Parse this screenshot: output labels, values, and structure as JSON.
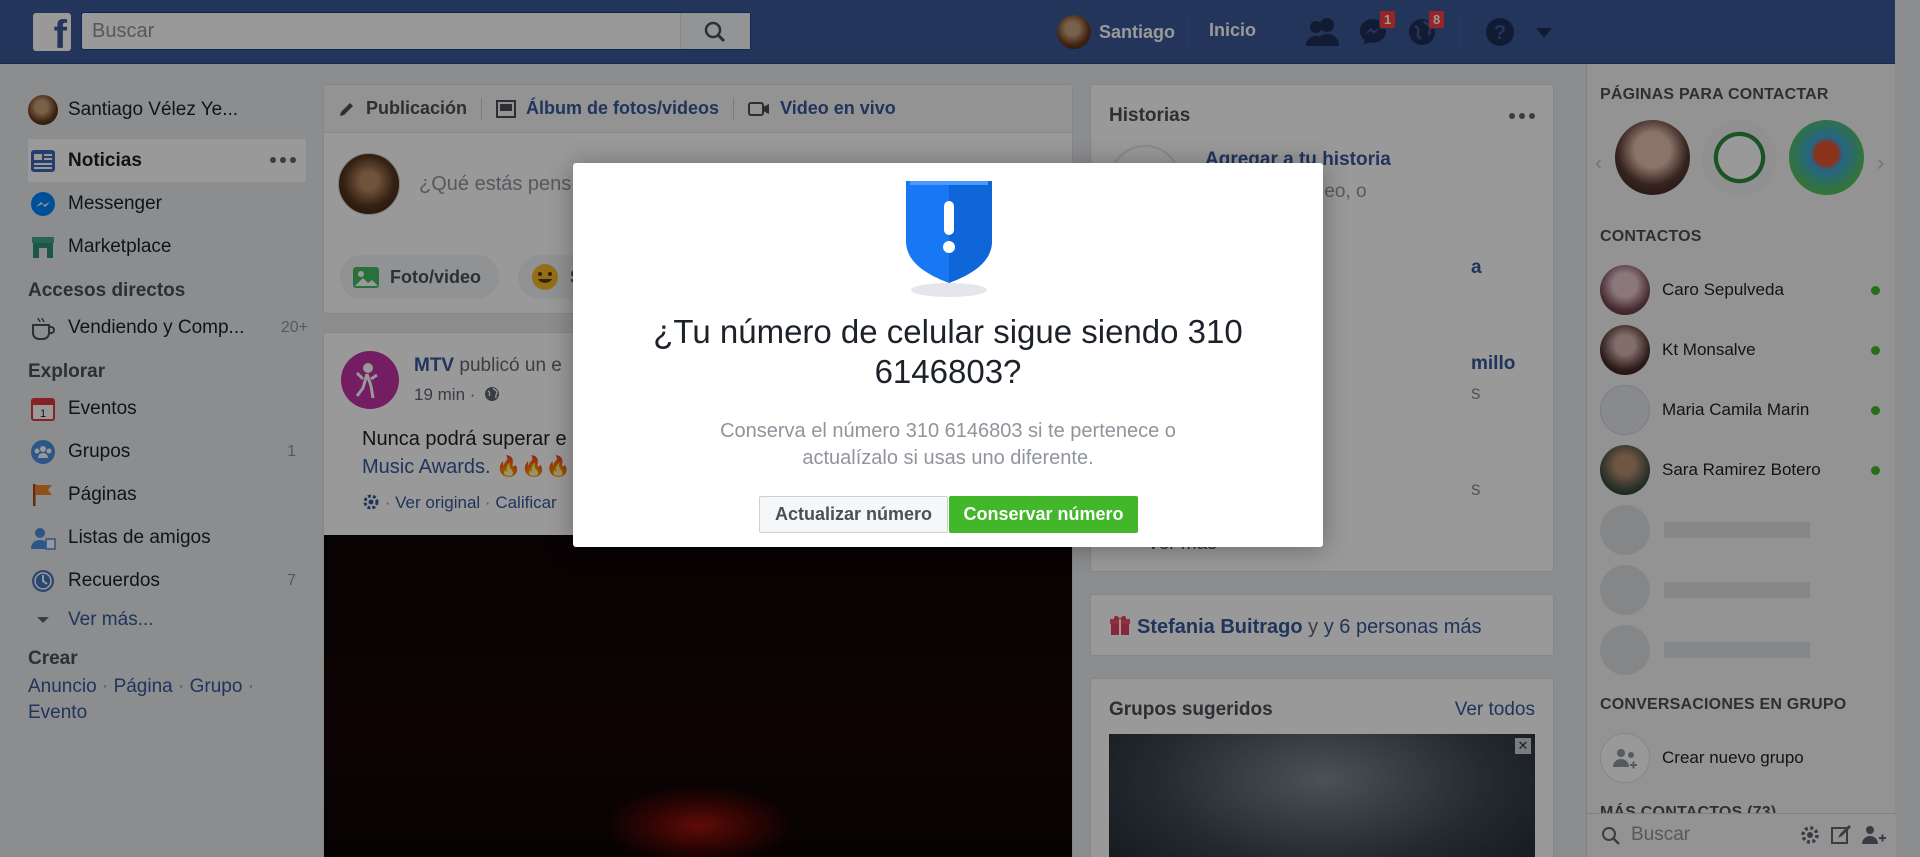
{
  "topbar": {
    "logo_letter": "f",
    "search_placeholder": "Buscar",
    "user_name": "Santiago",
    "home_label": "Inicio",
    "messages_badge": "1",
    "notifications_badge": "8",
    "brand_color": "#3b5998"
  },
  "left_nav": {
    "profile_name": "Santiago Vélez Ye...",
    "items": [
      {
        "label": "Noticias",
        "icon": "news-feed-icon"
      },
      {
        "label": "Messenger",
        "icon": "messenger-icon"
      },
      {
        "label": "Marketplace",
        "icon": "marketplace-icon"
      }
    ],
    "shortcuts_heading": "Accesos directos",
    "shortcuts": [
      {
        "label": "Vendiendo y Comp...",
        "count": "20+"
      }
    ],
    "explore_heading": "Explorar",
    "explore": [
      {
        "label": "Eventos",
        "count": ""
      },
      {
        "label": "Grupos",
        "count": "1"
      },
      {
        "label": "Páginas",
        "count": ""
      },
      {
        "label": "Listas de amigos",
        "count": ""
      },
      {
        "label": "Recuerdos",
        "count": "7"
      }
    ],
    "see_more": "Ver más...",
    "create_heading": "Crear",
    "create_links": [
      "Anuncio",
      "Página",
      "Grupo",
      "Evento"
    ]
  },
  "composer": {
    "tab_post": "Publicación",
    "tab_album": "Álbum de fotos/videos",
    "tab_live": "Video en vivo",
    "placeholder": "¿Qué estás pens",
    "photo_video": "Foto/video",
    "feeling_initial": "S"
  },
  "post": {
    "author": "MTV",
    "action": "publicó un e",
    "time": "19 min ·",
    "text_line1": "Nunca podrá superar e",
    "text_line2": "Music Awards. 🔥🔥🔥",
    "see_original": "Ver original",
    "rate": "Calificar"
  },
  "stories": {
    "title": "Historias",
    "add_story": "Agregar a tu historia",
    "add_story_sub": "a foto o un video, o",
    "partial_1": "a",
    "partial_2": "millo",
    "partial_3": "s",
    "partial_4": "s",
    "partial_5": "Ver más"
  },
  "birthday": {
    "name": "Stefania Buitrago",
    "rest": "y 6 personas más"
  },
  "groups": {
    "title": "Grupos sugeridos",
    "see_all": "Ver todos"
  },
  "chat": {
    "pages_heading": "PÁGINAS PARA CONTACTAR",
    "contacts_heading": "CONTACTOS",
    "contacts": [
      {
        "name": "Caro Sepulveda"
      },
      {
        "name": "Kt Monsalve"
      },
      {
        "name": "Maria Camila Marin"
      },
      {
        "name": "Sara Ramirez Botero"
      }
    ],
    "group_heading": "CONVERSACIONES EN GRUPO",
    "new_group": "Crear nuevo grupo",
    "more_contacts": "MÁS CONTACTOS (73)",
    "search_placeholder": "Buscar"
  },
  "modal": {
    "title": "¿Tu número de celular sigue siendo 310 6146803?",
    "body": "Conserva el número 310 6146803 si te pertenece o actualízalo si usas uno diferente.",
    "update_label": "Actualizar número",
    "keep_label": "Conservar número",
    "keep_color": "#42b72a",
    "shield_color": "#1877f2"
  }
}
